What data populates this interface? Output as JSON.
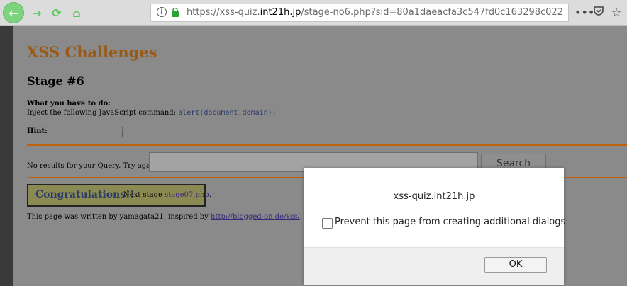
{
  "browser": {
    "url_prefix": "https://xss-quiz.",
    "url_host": "int21h.jp",
    "url_path": "/stage-no6.php?sid=80a1daeacfa3c547fd0c163298c022",
    "icons": {
      "back": "back-arrow-icon",
      "forward": "forward-arrow-icon",
      "reload": "reload-icon",
      "home": "home-icon",
      "info": "info-icon",
      "lock": "lock-icon",
      "menu": "more-icon",
      "pocket": "pocket-icon",
      "bookmark": "star-icon"
    }
  },
  "page": {
    "title": "XSS Challenges",
    "stage": "Stage #6",
    "what_label": "What you have to do:",
    "inject_text": "Inject the following JavaScript command: ",
    "inject_code": "alert(document.domain);",
    "hint_label": "Hint:",
    "query_text": "No results for your Query. Try again:",
    "search_label": "Search",
    "congrats_title": "Congratulations!!",
    "next_prefix": "Next stage ",
    "next_link": "stage07.php",
    "next_suffix": ".",
    "footer_text": "This page was written by yamagata21, inspired by ",
    "footer_link": "http://blogged-on.de/xss/",
    "footer_suffix": "."
  },
  "dialog": {
    "message": "xss-quiz.int21h.jp",
    "checkbox_label": "Prevent this page from creating additional dialogs",
    "ok_label": "OK"
  },
  "colors": {
    "accent_orange": "#c2610b",
    "title_color": "#9a5a14",
    "nav_green": "#5cc85c"
  }
}
